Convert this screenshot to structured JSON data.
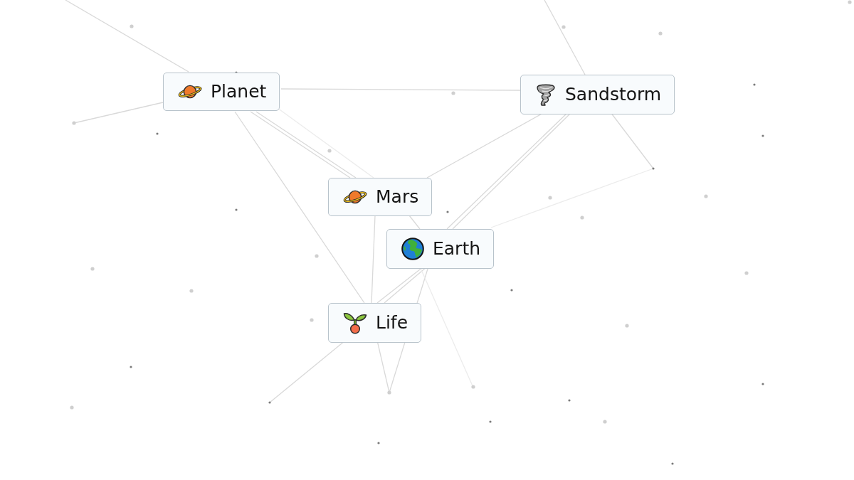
{
  "canvas": {
    "elements": [
      {
        "label": "Planet",
        "kind": "planet"
      },
      {
        "label": "Sandstorm",
        "kind": "tornado"
      },
      {
        "label": "Mars",
        "kind": "planet"
      },
      {
        "label": "Earth",
        "kind": "globe"
      },
      {
        "label": "Life",
        "kind": "sprout"
      }
    ]
  }
}
